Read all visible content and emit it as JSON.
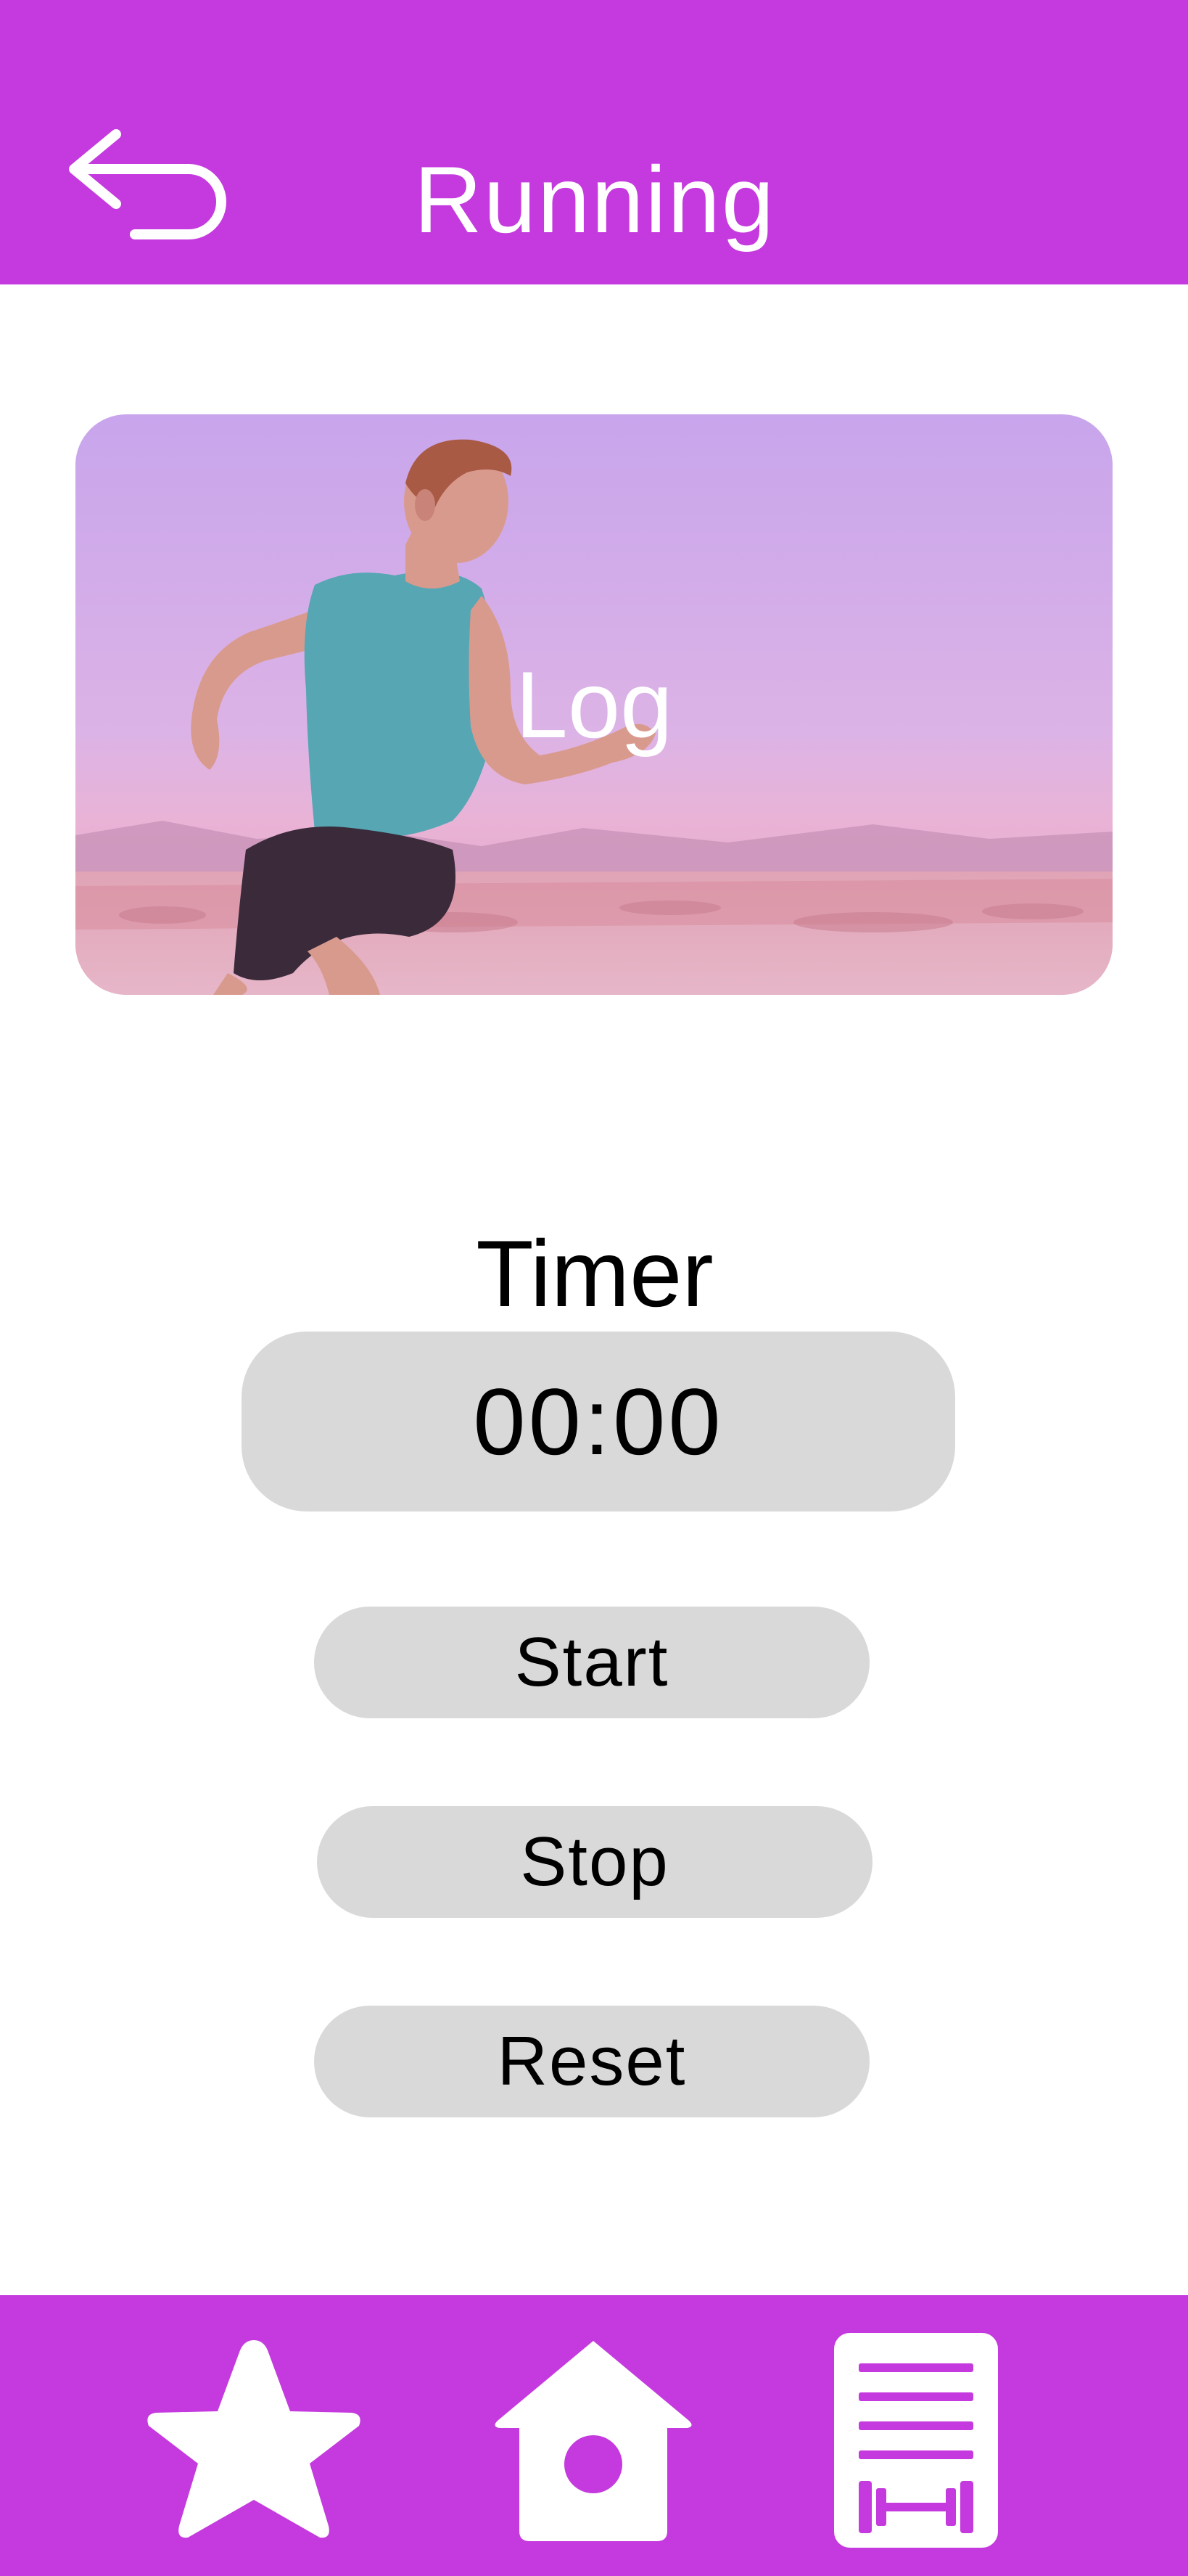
{
  "header": {
    "title": "Running",
    "back_icon": "back-arrow-icon",
    "background_color": "#c53ade"
  },
  "log_card": {
    "label": "Log",
    "image_description_icon": "runner-photo"
  },
  "timer": {
    "title": "Timer",
    "display": "00:00"
  },
  "controls": {
    "start_label": "Start",
    "stop_label": "Stop",
    "reset_label": "Reset"
  },
  "bottom_nav": {
    "items": [
      {
        "icon": "star-icon"
      },
      {
        "icon": "home-icon"
      },
      {
        "icon": "workout-log-icon"
      }
    ],
    "background_color": "#c53ade"
  }
}
